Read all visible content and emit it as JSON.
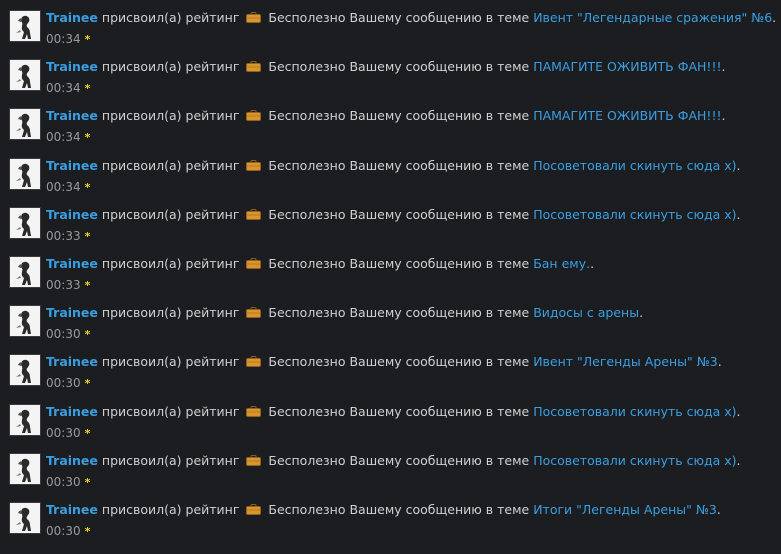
{
  "feed": {
    "items": [
      {
        "user": "Trainee",
        "action_pre": "присвоил(а) рейтинг",
        "rating": "Бесполезно",
        "action_post": "Вашему сообщению в теме",
        "thread": "Ивент \"Легендарные сражения\" №6",
        "suffix": ".",
        "time": "00:34"
      },
      {
        "user": "Trainee",
        "action_pre": "присвоил(а) рейтинг",
        "rating": "Бесполезно",
        "action_post": "Вашему сообщению в теме",
        "thread": "ПАМАГИТЕ ОЖИВИТЬ ФАН!!!",
        "suffix": ".",
        "time": "00:34"
      },
      {
        "user": "Trainee",
        "action_pre": "присвоил(а) рейтинг",
        "rating": "Бесполезно",
        "action_post": "Вашему сообщению в теме",
        "thread": "ПАМАГИТЕ ОЖИВИТЬ ФАН!!!",
        "suffix": ".",
        "time": "00:34"
      },
      {
        "user": "Trainee",
        "action_pre": "присвоил(а) рейтинг",
        "rating": "Бесполезно",
        "action_post": "Вашему сообщению в теме",
        "thread": "Посоветовали скинуть сюда х)",
        "suffix": ".",
        "time": "00:34"
      },
      {
        "user": "Trainee",
        "action_pre": "присвоил(а) рейтинг",
        "rating": "Бесполезно",
        "action_post": "Вашему сообщению в теме",
        "thread": "Посоветовали скинуть сюда х)",
        "suffix": ".",
        "time": "00:33"
      },
      {
        "user": "Trainee",
        "action_pre": "присвоил(а) рейтинг",
        "rating": "Бесполезно",
        "action_post": "Вашему сообщению в теме",
        "thread": "Бан ему.",
        "suffix": ".",
        "time": "00:33"
      },
      {
        "user": "Trainee",
        "action_pre": "присвоил(а) рейтинг",
        "rating": "Бесполезно",
        "action_post": "Вашему сообщению в теме",
        "thread": "Видосы с арены",
        "suffix": ".",
        "time": "00:30"
      },
      {
        "user": "Trainee",
        "action_pre": "присвоил(а) рейтинг",
        "rating": "Бесполезно",
        "action_post": "Вашему сообщению в теме",
        "thread": "Ивент \"Легенды Арены\" №3",
        "suffix": ".",
        "time": "00:30"
      },
      {
        "user": "Trainee",
        "action_pre": "присвоил(а) рейтинг",
        "rating": "Бесполезно",
        "action_post": "Вашему сообщению в теме",
        "thread": "Посоветовали скинуть сюда х)",
        "suffix": ".",
        "time": "00:30"
      },
      {
        "user": "Trainee",
        "action_pre": "присвоил(а) рейтинг",
        "rating": "Бесполезно",
        "action_post": "Вашему сообщению в теме",
        "thread": "Посоветовали скинуть сюда х)",
        "suffix": ".",
        "time": "00:30"
      },
      {
        "user": "Trainee",
        "action_pre": "присвоил(а) рейтинг",
        "rating": "Бесполезно",
        "action_post": "Вашему сообщению в теме",
        "thread": "Итоги \"Легенды Арены\" №3",
        "suffix": ".",
        "time": "00:30"
      }
    ],
    "star_glyph": "*",
    "rating_icon": "briefcase-icon",
    "colors": {
      "link": "#3a9fe2",
      "star": "#f1d51a",
      "background": "#1c1d20"
    }
  }
}
